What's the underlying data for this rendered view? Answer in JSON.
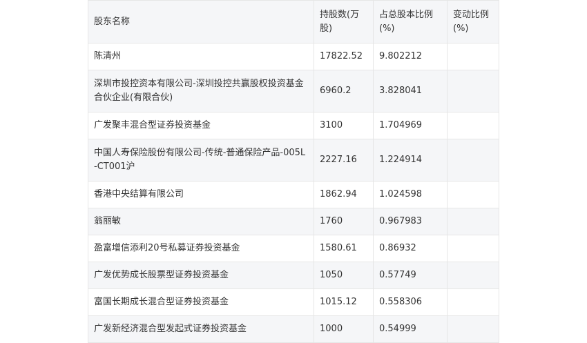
{
  "table": {
    "headers": [
      "股东名称",
      "持股数(万股)",
      "占总股本比例(%)",
      "变动比例(%)"
    ],
    "rows": [
      {
        "name": "陈清州",
        "shares": "17822.52",
        "ratio": "9.802212",
        "change": ""
      },
      {
        "name": "深圳市投控资本有限公司-深圳投控共赢股权投资基金合伙企业(有限合伙)",
        "shares": "6960.2",
        "ratio": "3.828041",
        "change": ""
      },
      {
        "name": "广发聚丰混合型证券投资基金",
        "shares": "3100",
        "ratio": "1.704969",
        "change": ""
      },
      {
        "name": "中国人寿保险股份有限公司-传统-普通保险产品-005L-CT001沪",
        "shares": "2227.16",
        "ratio": "1.224914",
        "change": ""
      },
      {
        "name": "香港中央结算有限公司",
        "shares": "1862.94",
        "ratio": "1.024598",
        "change": ""
      },
      {
        "name": "翁丽敏",
        "shares": "1760",
        "ratio": "0.967983",
        "change": ""
      },
      {
        "name": "盈富增信添利20号私募证券投资基金",
        "shares": "1580.61",
        "ratio": "0.86932",
        "change": ""
      },
      {
        "name": "广发优势成长股票型证券投资基金",
        "shares": "1050",
        "ratio": "0.57749",
        "change": ""
      },
      {
        "name": "富国长期成长混合型证券投资基金",
        "shares": "1015.12",
        "ratio": "0.558306",
        "change": ""
      },
      {
        "name": "广发新经济混合型发起式证券投资基金",
        "shares": "1000",
        "ratio": "0.54999",
        "change": ""
      }
    ]
  }
}
